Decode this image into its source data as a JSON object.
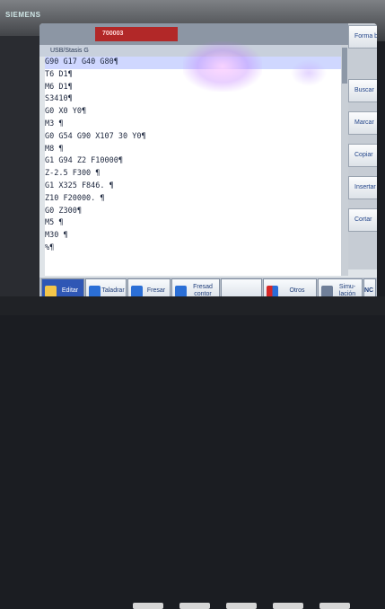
{
  "brand": "SIEMENS",
  "program": {
    "tab_label": "700003",
    "path": "USB/Stasis G",
    "lines": [
      "G90 G17 G40 G80¶",
      "T6 D1¶",
      "M6 D1¶",
      "S3410¶",
      "G0 X0 Y0¶",
      "M3 ¶",
      "G0 G54 G90 X107 30 Y0¶",
      "M8 ¶",
      "G1 G94 Z2 F10000¶",
      "Z-2.5 F300 ¶",
      "G1 X325 F846. ¶",
      "Z10 F20000. ¶",
      "G0 Z300¶",
      "M5 ¶",
      "M30 ¶",
      "%¶"
    ],
    "current_line_index": 0
  },
  "softkeys_right": [
    "Forma bloque",
    "Buscar",
    "Marcar",
    "Copiar",
    "Insertar",
    "Cortar"
  ],
  "softkeys_bottom": {
    "editar": "Editar",
    "taladrar": "Taladrar",
    "fresar": "Fresar",
    "fresad_contor": "Fresad contor",
    "otros": "Otros",
    "simulacion": "Simu-lación",
    "nc": "NC"
  },
  "colors": {
    "accent": "#2f57b5",
    "tab_red": "#b22828",
    "screen_bg": "#dfe4e8"
  }
}
